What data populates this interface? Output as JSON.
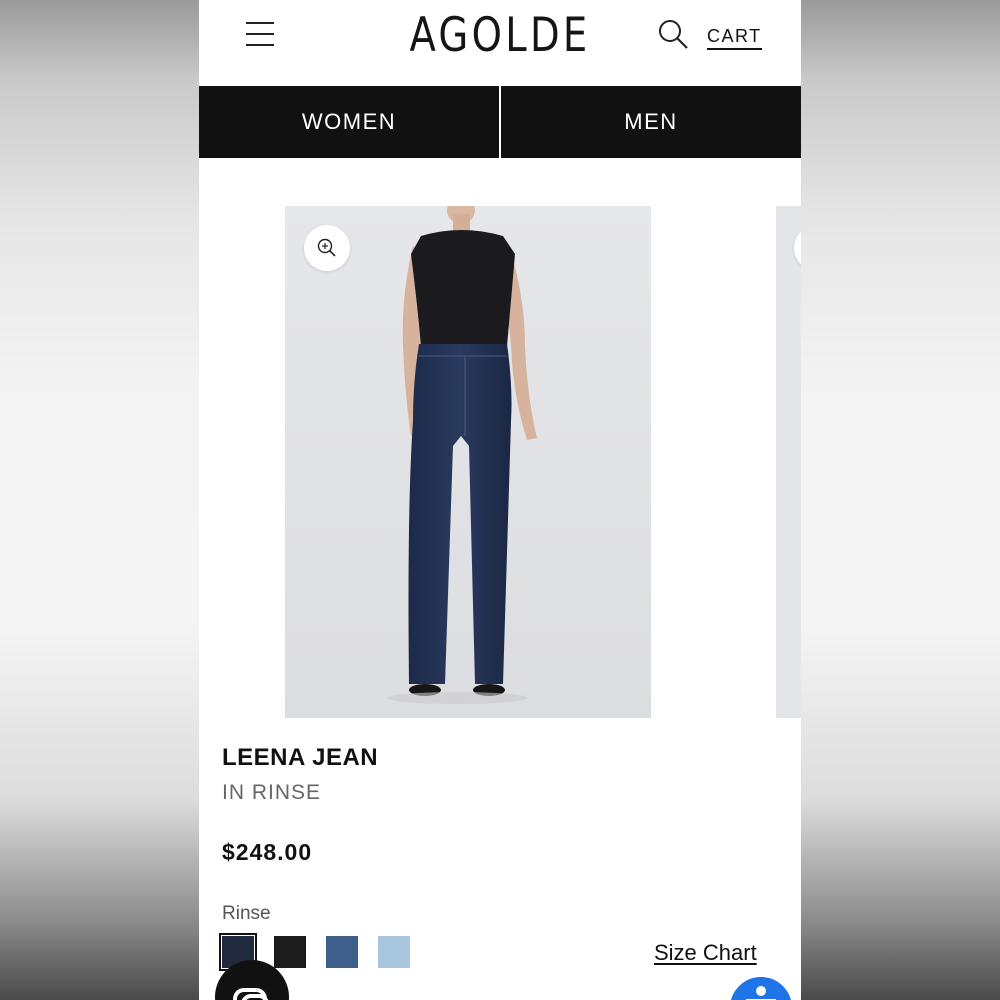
{
  "header": {
    "logo": "AGOLDE",
    "cart_label": "CART"
  },
  "nav": {
    "tabs": [
      {
        "label": "WOMEN"
      },
      {
        "label": "MEN"
      }
    ]
  },
  "product": {
    "name": "LEENA JEAN",
    "color_name": "IN RINSE",
    "price": "$248.00",
    "color_label": "Rinse",
    "swatches": [
      {
        "color": "#1f2a3e",
        "selected": true
      },
      {
        "color": "#1c1c1c",
        "selected": false
      },
      {
        "color": "#3c5f8c",
        "selected": false
      },
      {
        "color": "#a9c6e0",
        "selected": false
      }
    ],
    "size_chart_label": "Size Chart"
  },
  "icons": [
    "menu-icon",
    "search-icon",
    "zoom-in-icon",
    "chat-icon",
    "accessibility-icon"
  ]
}
